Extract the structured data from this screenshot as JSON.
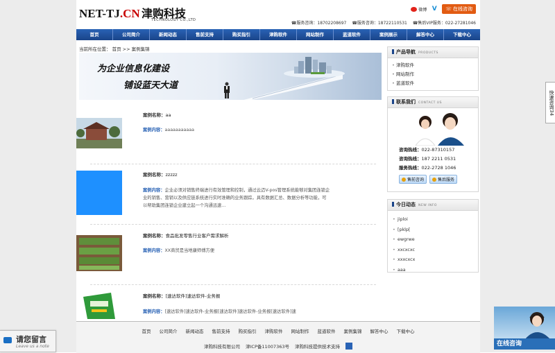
{
  "header": {
    "logo_main": "NET-TJ",
    "logo_dot_cn": ".CN",
    "logo_cn": "津购科技",
    "logo_sub": "TECHNOLOGY CO.,LTD",
    "weibo_label": "微博",
    "online_button": "在线咨询",
    "hotlines": [
      "服务咨询：18702208697",
      "服务咨询：18722110531",
      "售后VIP服务：022-27281046"
    ]
  },
  "nav": [
    "首页",
    "公司简介",
    "新闻动态",
    "售前支持",
    "购买指引",
    "津购软件",
    "网站制作",
    "蓝道软件",
    "案例展示",
    "解答中心",
    "下载中心"
  ],
  "breadcrumb": {
    "prefix": "当前所在位置：",
    "home": "首页",
    "sep": ">>",
    "current": "案例集锦"
  },
  "banner": {
    "line1": "为企业信息化建设",
    "line2": "铺设蓝天大道"
  },
  "cases": [
    {
      "title_label": "案例名称：",
      "title": "aa",
      "content_label": "案例内容：",
      "content": "aaaaaaaaaaa"
    },
    {
      "title_label": "案例名称：",
      "title": "zzzzz",
      "content_label": "案例内容：",
      "content": "企业必须对销售终端进行有效管理和控制，通过云迈V-pos管理系统能够对集团连锁企业的销售、营销以及供应链系统进行实时准确的业务跟踪，具有数据汇总、数据分析等功能，可以帮助集团连锁企业建立起一个沟通迅速..."
    },
    {
      "title_label": "案例名称：",
      "title": "食品批发零售行业客户需求解析",
      "content_label": "案例内容：",
      "content": "XX商贸是当地康师傅方便"
    },
    {
      "title_label": "案例名称：",
      "title": "[速达软件]速达软件-业务报",
      "content_label": "案例内容：",
      "content": "[速达软件]速达软件-业务报[速达软件]速达软件-业务报[速达软件]速"
    }
  ],
  "sidebar": {
    "products": {
      "title": "产品导航",
      "title_en": "PRODUCTS",
      "items": [
        "津购软件",
        "网站制作",
        "蓝道软件"
      ]
    },
    "contact": {
      "title": "联系我们",
      "title_en": "CONTACT US",
      "lines": [
        {
          "label": "咨询热线：",
          "value": "022-87310157"
        },
        {
          "label": "咨询热线：",
          "value": "187 2211 0531"
        },
        {
          "label": "服务热线：",
          "value": "022-2728 1046"
        }
      ],
      "btn_pre": "售前咨询",
      "btn_post": "售后服务"
    },
    "news": {
      "title": "今日动态",
      "title_en": "NEW INFO",
      "items": [
        "jiploi",
        "[pklp[",
        "ewgrwe",
        "xxcxcxc",
        "xxxcxcx",
        "aaa"
      ]
    }
  },
  "footer": {
    "links": [
      "首页",
      "公司简介",
      "新闻动态",
      "售前支持",
      "购买指引",
      "津购软件",
      "网站制作",
      "蓝道软件",
      "案例集锦",
      "解答中心",
      "下载中心"
    ],
    "company": "津购科技有限公司",
    "icp": "津ICP备11007363号",
    "support": "津购科技提供技术支持"
  },
  "widgets": {
    "leave_msg": "请您留言",
    "leave_msg_en": "Leave us a note",
    "side_consult": "快速咨询",
    "side_consult_num": "34",
    "consult_card": "在线咨询"
  },
  "colors": {
    "nav_blue": "#2a63b5",
    "accent_red": "#c80000",
    "online_orange": "#e25b12"
  }
}
